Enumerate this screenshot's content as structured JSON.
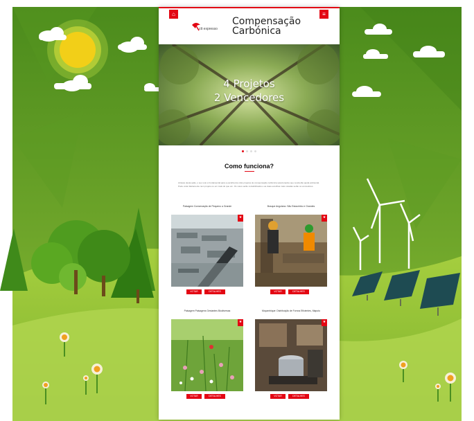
{
  "header": {
    "title_line1": "Compensação",
    "title_line2": "Carbónica",
    "logo_text": "ctt expresso",
    "home_icon": "home-icon",
    "menu_icon": "menu-icon"
  },
  "hero": {
    "line1": "4 Projetos",
    "line2": "2 Vencedores"
  },
  "carousel": {
    "count": 4,
    "active": 1
  },
  "how": {
    "title": "Como funciona?",
    "intro": "Através desta ação, o seu voto é fundamental para a escolha dos dois projetos de compensação carbónica selecionados que receberão ajuda ambiental. Pode votar diariamente num projeto ou em mais do que um. Os votos serão contabilizados e as duas escolhas mais votadas serão os vencedores."
  },
  "cards": [
    {
      "title": "Paisagem Conservação de Pequeno a Grande",
      "vote": "VOTAR",
      "details": "DETALHES"
    },
    {
      "title": "Bosque Angolano: São Estaurinho e Grandes",
      "vote": "VOTAR",
      "details": "DETALHES"
    },
    {
      "title": "Paisagem Paisagens Gestantes Biodiversas",
      "vote": "VOTAR",
      "details": "DETALHES"
    },
    {
      "title": "Moçambique: Distribuição de Fornos Eficientes, Maputo",
      "vote": "VOTAR",
      "details": "DETALHES"
    }
  ],
  "colors": {
    "brand_red": "#e30613",
    "grass_light": "#8dc63f",
    "grass_dark": "#2e7d12"
  }
}
